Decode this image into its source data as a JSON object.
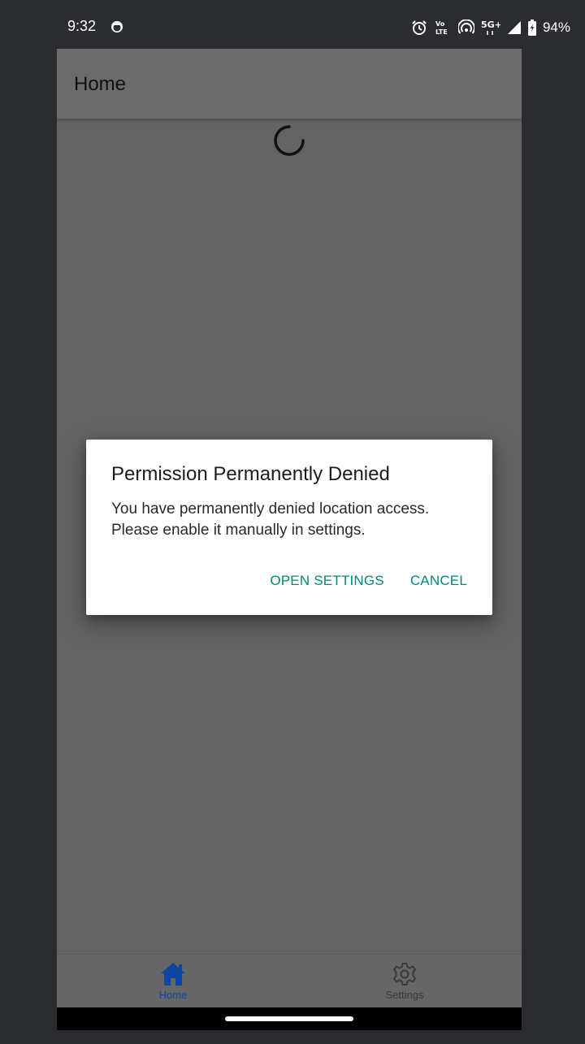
{
  "status_bar": {
    "time": "9:32",
    "battery_percent": "94%",
    "icons": [
      "app-notification-icon",
      "alarm-icon",
      "volte-icon",
      "hotspot-icon",
      "5g-plus-icon",
      "signal-icon",
      "battery-charging-icon"
    ],
    "network_label": "5G+",
    "volte_label_top": "Vo",
    "volte_label_bottom": "LTE"
  },
  "app_bar": {
    "title": "Home"
  },
  "dialog": {
    "title": "Permission Permanently Denied",
    "message": "You have permanently denied location access. Please enable it manually in settings.",
    "open_settings_label": "OPEN SETTINGS",
    "cancel_label": "CANCEL",
    "accent_color": "#00897b"
  },
  "bottom_nav": {
    "items": [
      {
        "label": "Home",
        "icon": "home-icon",
        "active": true
      },
      {
        "label": "Settings",
        "icon": "gear-icon",
        "active": false
      }
    ],
    "active_color": "#0d47a1"
  }
}
